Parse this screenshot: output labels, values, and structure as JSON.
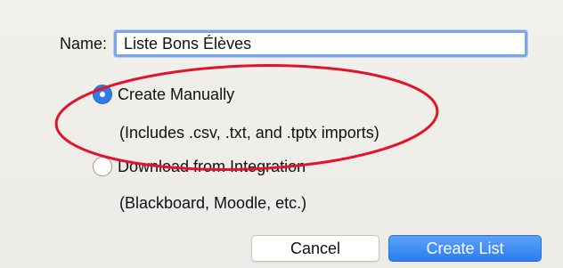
{
  "form": {
    "name_label": "Name:",
    "name_value": "Liste Bons Élèves"
  },
  "options": {
    "manual": {
      "label": "Create Manually",
      "hint": "(Includes .csv, .txt, and .tptx imports)",
      "selected": true
    },
    "integration": {
      "label": "Download from Integration",
      "hint": "(Blackboard, Moodle, etc.)",
      "selected": false
    }
  },
  "buttons": {
    "cancel": "Cancel",
    "create": "Create List"
  },
  "colors": {
    "accent": "#2f7ee8",
    "annotation": "#e0142a"
  }
}
